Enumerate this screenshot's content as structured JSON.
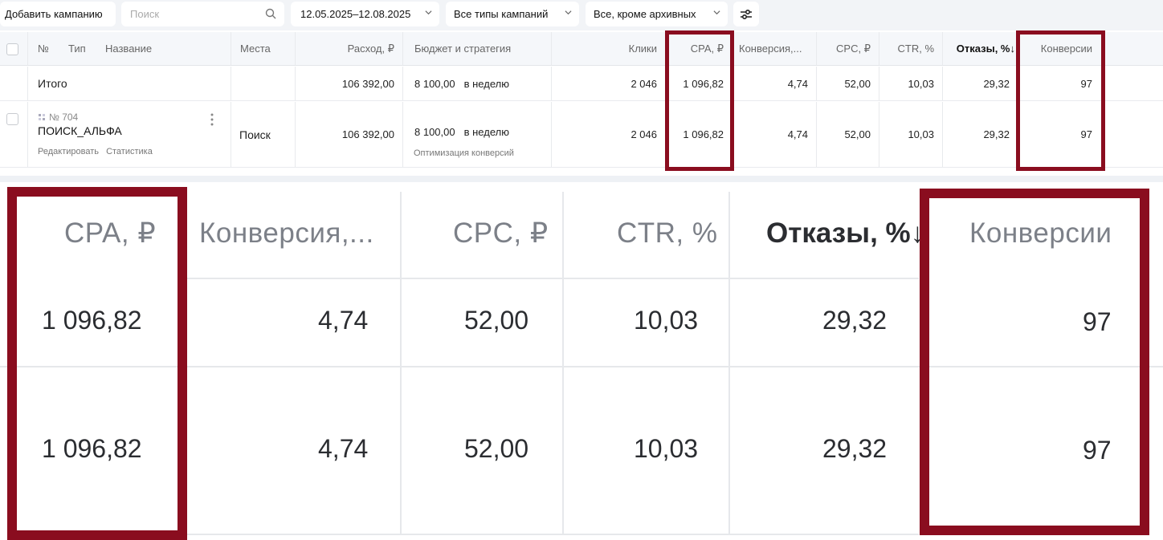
{
  "toolbar": {
    "add_campaign": "Добавить кампанию",
    "search_placeholder": "Поиск",
    "date_range": "12.05.2025–12.08.2025",
    "campaign_types": "Все типы кампаний",
    "archive_filter": "Все, кроме архивных"
  },
  "table": {
    "headers": {
      "number": "№",
      "type": "Тип",
      "name": "Название",
      "places": "Места",
      "spend": "Расход, ₽",
      "budget": "Бюджет и стратегия",
      "clicks": "Клики",
      "cpa": "CPA, ₽",
      "conv_rate": "Конверсия,...",
      "cpc": "CPC, ₽",
      "ctr": "CTR, %",
      "bounces": "Отказы, %↓",
      "conversions": "Конверсии"
    },
    "total": {
      "label": "Итого",
      "spend": "106 392,00",
      "budget_amount": "8 100,00",
      "budget_period": "в неделю",
      "clicks": "2 046",
      "cpa": "1 096,82",
      "conv_rate": "4,74",
      "cpc": "52,00",
      "ctr": "10,03",
      "bounces": "29,32",
      "conversions": "97"
    },
    "campaign": {
      "id": "№ 704",
      "name": "ПОИСК_АЛЬФА",
      "edit_link": "Редактировать",
      "stats_link": "Статистика",
      "places": "Поиск",
      "spend": "106 392,00",
      "budget_amount": "8 100,00",
      "budget_period": "в неделю",
      "strategy": "Оптимизация конверсий",
      "clicks": "2 046",
      "cpa": "1 096,82",
      "conv_rate": "4,74",
      "cpc": "52,00",
      "ctr": "10,03",
      "bounces": "29,32",
      "conversions": "97"
    }
  },
  "highlight_color": "#8a0d1f"
}
